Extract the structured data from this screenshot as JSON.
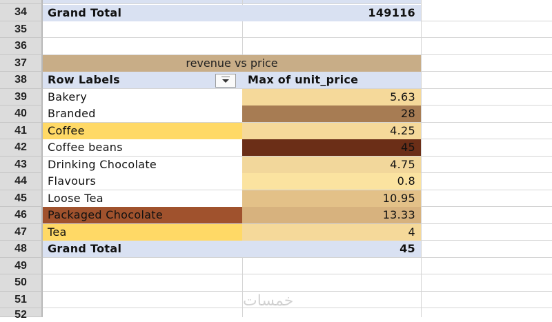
{
  "sheet": {
    "row_numbers": [
      "34",
      "35",
      "36",
      "37",
      "38",
      "39",
      "40",
      "41",
      "42",
      "43",
      "44",
      "45",
      "46",
      "47",
      "48",
      "49",
      "50",
      "51",
      "52"
    ],
    "top_total": {
      "label": "Grand Total",
      "value": "149116"
    },
    "pivot": {
      "title": "revenue vs price",
      "header": {
        "row_labels": "Row Labels",
        "value_header": "Max of unit_price"
      },
      "rows": [
        {
          "label": "Bakery",
          "value": "5.63",
          "label_bg": "#ffffff",
          "value_bg": "#f5d99a"
        },
        {
          "label": "Branded",
          "value": "28",
          "label_bg": "#ffffff",
          "value_bg": "#a77c53"
        },
        {
          "label": "Coffee",
          "value": "4.25",
          "label_bg": "#ffd966",
          "value_bg": "#f5d99a"
        },
        {
          "label": "Coffee beans",
          "value": "45",
          "label_bg": "#ffffff",
          "value_bg": "#6b2e17"
        },
        {
          "label": "Drinking Chocolate",
          "value": "4.75",
          "label_bg": "#ffffff",
          "value_bg": "#f2d79b"
        },
        {
          "label": "Flavours",
          "value": "0.8",
          "label_bg": "#ffffff",
          "value_bg": "#fbe3a0"
        },
        {
          "label": "Loose Tea",
          "value": "10.95",
          "label_bg": "#ffffff",
          "value_bg": "#e3c188"
        },
        {
          "label": "Packaged Chocolate",
          "value": "13.33",
          "label_bg": "#a0522d",
          "value_bg": "#d7b27e"
        },
        {
          "label": "Tea",
          "value": "4",
          "label_bg": "#ffd966",
          "value_bg": "#f5d99a"
        }
      ],
      "grand_total": {
        "label": "Grand Total",
        "value": "45"
      }
    },
    "watermark": "خمسات"
  }
}
